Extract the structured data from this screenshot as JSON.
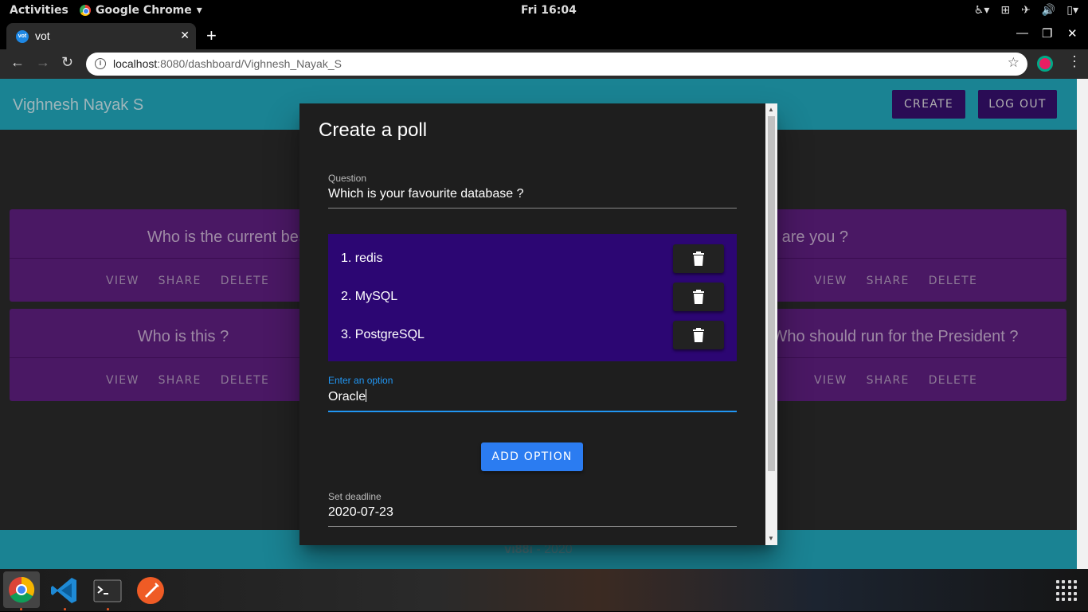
{
  "system": {
    "activities": "Activities",
    "app_name": "Google Chrome",
    "clock": "Fri 16:04"
  },
  "browser": {
    "tab_title": "vot",
    "favicon_text": "vot",
    "url_host": "localhost",
    "url_path": ":8080/dashboard/Vighnesh_Nayak_S"
  },
  "app": {
    "user_name": "Vighnesh Nayak S",
    "create_label": "CREATE",
    "logout_label": "LOG OUT",
    "footer_brand": "vi88i",
    "footer_year": " - 2020"
  },
  "polls": [
    {
      "question": "Who is the current best player at Man",
      "actions": [
        "VIEW",
        "SHARE",
        "DELETE"
      ]
    },
    {
      "question": "Who are you ?",
      "actions": [
        "VIEW",
        "SHARE",
        "DELETE"
      ]
    },
    {
      "question": "Who is this ?",
      "actions": [
        "VIEW",
        "SHARE",
        "DELETE"
      ]
    },
    {
      "question": "Who should run for the President ?",
      "actions": [
        "VIEW",
        "SHARE",
        "DELETE"
      ]
    }
  ],
  "dialog": {
    "title": "Create a poll",
    "question_label": "Question",
    "question_value": "Which is your favourite database ?",
    "options": [
      "1. redis",
      "2. MySQL",
      "3. PostgreSQL"
    ],
    "option_label": "Enter an option",
    "option_value": "Oracle",
    "add_option_label": "ADD OPTION",
    "deadline_label": "Set deadline",
    "deadline_value": "2020-07-23"
  },
  "colors": {
    "appbar": "#1a8393",
    "card": "#4a1864",
    "option_list": "#2c0673",
    "accent": "#2b7cf1"
  }
}
